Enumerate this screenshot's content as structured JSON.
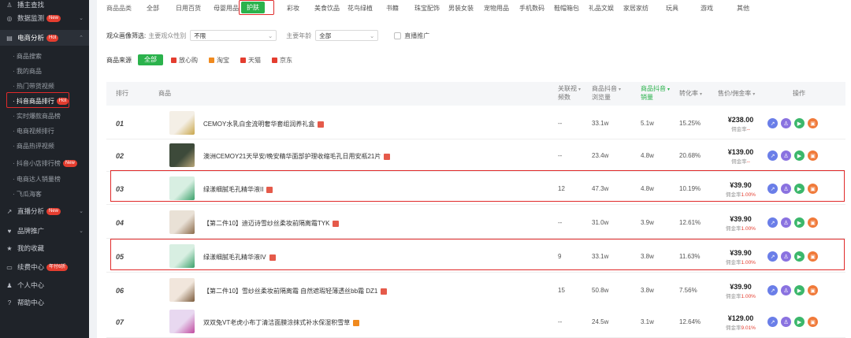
{
  "sidebar": {
    "items": [
      {
        "label": "播主查找",
        "icon": "user-icon"
      },
      {
        "label": "数据监测",
        "icon": "monitor-icon",
        "badge": "New"
      },
      {
        "label": "电商分析",
        "icon": "cart-icon",
        "badge": "Hot"
      }
    ],
    "sub_items": [
      {
        "label": "· 商品搜索"
      },
      {
        "label": "· 我的商品"
      },
      {
        "label": "· 热门带货视频"
      },
      {
        "label": "· 抖音商品排行",
        "badge": "Hot"
      },
      {
        "label": "· 实时爆款商品榜"
      },
      {
        "label": "· 电商视频排行"
      },
      {
        "label": "· 商品热评视频"
      },
      {
        "label": "· 抖音小店排行榜",
        "badge": "New"
      },
      {
        "label": "· 电商达人销量榜"
      },
      {
        "label": "· 飞瓜海客"
      }
    ],
    "more_items": [
      {
        "label": "直播分析",
        "icon": "live-icon",
        "badge": "New"
      },
      {
        "label": "品牌推广",
        "icon": "heart-icon"
      },
      {
        "label": "我的收藏",
        "icon": "star-icon"
      },
      {
        "label": "续费中心",
        "icon": "card-icon",
        "badge": "年付6折"
      },
      {
        "label": "个人中心",
        "icon": "person-icon"
      },
      {
        "label": "帮助中心",
        "icon": "help-icon"
      }
    ]
  },
  "filters": {
    "category_label": "商品品类",
    "categories": [
      "全部",
      "日用百货",
      "母婴用品",
      "护肤",
      "彩妆",
      "美食饮品",
      "花鸟绿植",
      "书籍",
      "珠宝配饰",
      "男装女装",
      "宠物用品",
      "手机数码",
      "鞋帽箱包",
      "礼品文娱",
      "家居家纺",
      "玩具",
      "游戏",
      "其他"
    ],
    "active_category": "护肤",
    "audience_label": "观众画像筛选:",
    "gender_label": "主要观众性别",
    "gender_value": "不限",
    "age_label": "主要年龄",
    "age_value": "全部",
    "live_promo_label": "直播推广",
    "source_label": "商品来源",
    "sources": [
      {
        "label": "全部"
      },
      {
        "label": "放心购",
        "color": "#e43d2f"
      },
      {
        "label": "淘宝",
        "color": "#f08a1e"
      },
      {
        "label": "天猫",
        "color": "#e43d2f"
      },
      {
        "label": "京东",
        "color": "#e43d2f"
      }
    ]
  },
  "table": {
    "headers": {
      "rank": "排行",
      "product": "商品",
      "related_line1": "关联视",
      "related_line2": "频数",
      "views_line1": "商品抖音",
      "views_line2": "浏览量",
      "sales_line1": "商品抖音",
      "sales_line2": "销量",
      "conversion": "转化率",
      "price": "售价/佣金率",
      "ops": "操作"
    },
    "rows": [
      {
        "rank": "01",
        "name": "CEMOY水乳白金流明奢华套组润养礼盒",
        "related": "--",
        "views": "33.1w",
        "sales": "5.1w",
        "conversion": "15.25%",
        "price": "¥238.00",
        "commission_label": "佣金率",
        "commission": "--"
      },
      {
        "rank": "02",
        "name": "澳洲CEMOY21天早安/晚安精华面部护理收缩毛孔日用安瓶21片",
        "related": "--",
        "views": "23.4w",
        "sales": "4.8w",
        "conversion": "20.68%",
        "price": "¥139.00",
        "commission_label": "佣金率",
        "commission": "--"
      },
      {
        "rank": "03",
        "name": "绿漾细腻毛孔精华液II",
        "related": "12",
        "views": "47.3w",
        "sales": "4.8w",
        "conversion": "10.19%",
        "price": "¥39.90",
        "commission_label": "佣金率",
        "commission": "1.00%"
      },
      {
        "rank": "04",
        "name": "【第二件10】迪迈诗雪纱丝柔妆前隔离霜TYK",
        "related": "--",
        "views": "31.0w",
        "sales": "3.9w",
        "conversion": "12.61%",
        "price": "¥39.90",
        "commission_label": "佣金率",
        "commission": "1.00%"
      },
      {
        "rank": "05",
        "name": "绿漾细腻毛孔精华液IV",
        "related": "9",
        "views": "33.1w",
        "sales": "3.8w",
        "conversion": "11.63%",
        "price": "¥39.90",
        "commission_label": "佣金率",
        "commission": "1.00%"
      },
      {
        "rank": "06",
        "name": "【第二件10】雪纱丝柔妆前隔离霜 自然遮瑕轻薄透丝bb霜 DZ1",
        "related": "15",
        "views": "50.8w",
        "sales": "3.8w",
        "conversion": "7.56%",
        "price": "¥39.90",
        "commission_label": "佣金率",
        "commission": "1.00%"
      },
      {
        "rank": "07",
        "name": "双双兔VT老虎小布丁清洁面膜涂抹式补水保湿积雪草",
        "related": "--",
        "views": "24.5w",
        "sales": "3.1w",
        "conversion": "12.64%",
        "price": "¥129.00",
        "commission_label": "佣金率",
        "commission": "9.01%"
      }
    ]
  },
  "colors": {
    "accent": "#2bb24c",
    "highlight": "#e02a2a",
    "sidebar_bg": "#1f2329"
  }
}
